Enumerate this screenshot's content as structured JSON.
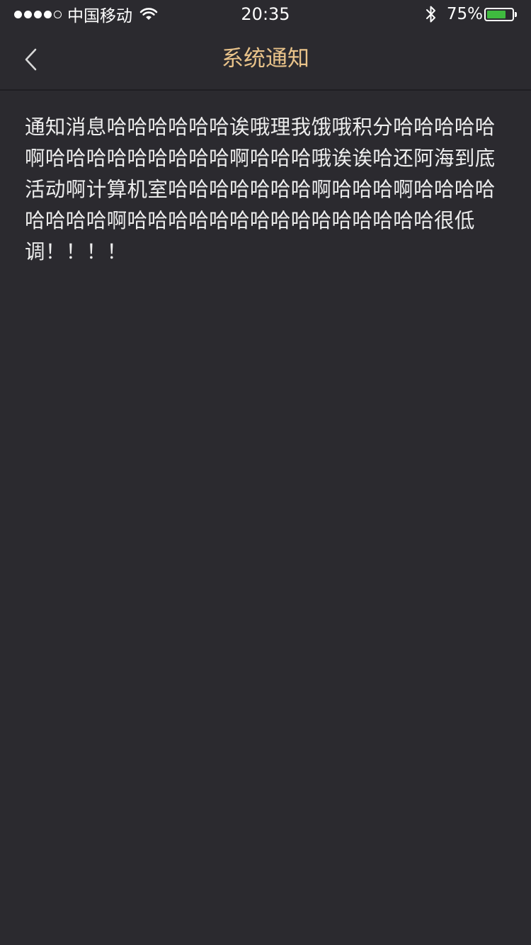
{
  "status_bar": {
    "carrier": "中国移动",
    "time": "20:35",
    "battery_percent": "75%",
    "battery_level": 0.75,
    "signal_bars_filled": 4,
    "signal_bars_total": 5,
    "icons": [
      "signal-dots",
      "wifi-icon",
      "bluetooth-icon",
      "battery-icon"
    ]
  },
  "nav": {
    "title": "系统通知",
    "back_icon": "chevron-left-icon"
  },
  "notification": {
    "body": "通知消息哈哈哈哈哈哈诶哦理我饿哦积分哈哈哈哈哈啊哈哈哈哈哈哈哈哈哈啊哈哈哈哦诶诶哈还阿海到底活动啊计算机室哈哈哈哈哈哈哈啊哈哈哈啊哈哈哈哈哈哈哈哈啊哈哈哈哈哈哈哈哈哈哈哈哈哈哈哈很低调！！！！"
  },
  "colors": {
    "background": "#2b2a2f",
    "title_accent": "#e9c38a",
    "battery_green": "#3fbb3f"
  }
}
